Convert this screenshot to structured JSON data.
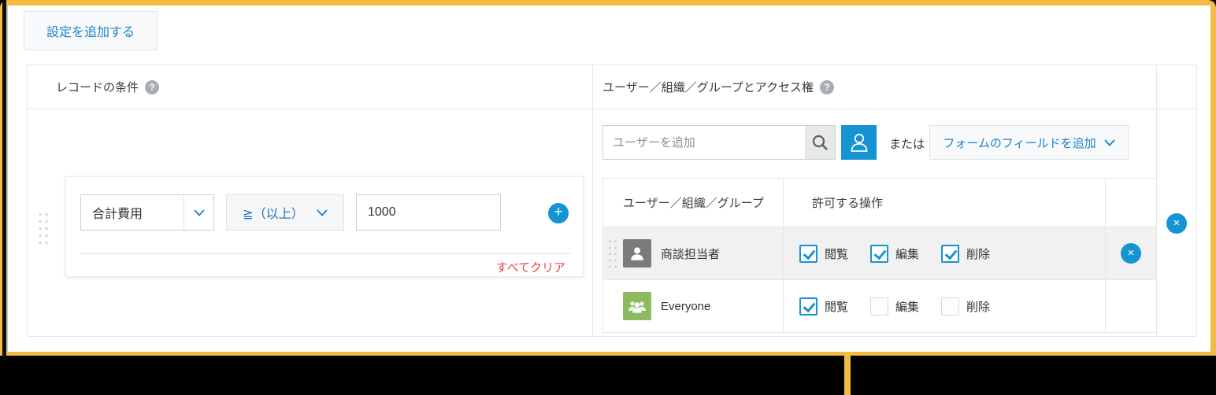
{
  "panel": {
    "add_setting_button": "設定を追加する"
  },
  "table": {
    "condition_header": "レコードの条件",
    "access_header": "ユーザー／組織／グループとアクセス権",
    "help_glyph": "?"
  },
  "condition": {
    "field": "合計費用",
    "operator": "≧（以上）",
    "value": "1000",
    "add_glyph": "+",
    "clear_all": "すべてクリア"
  },
  "access": {
    "search_placeholder": "ユーザーを追加",
    "or_text": "または",
    "form_field_button": "フォームのフィールドを追加",
    "columns": {
      "entity": "ユーザー／組織／グループ",
      "operations": "許可する操作"
    },
    "op_labels": {
      "view": "閲覧",
      "edit": "編集",
      "delete": "削除"
    },
    "remove_glyph": "×",
    "rows": [
      {
        "name": "商談担当者",
        "ops": {
          "view": true,
          "edit": true,
          "delete": true
        }
      },
      {
        "name": "Everyone",
        "ops": {
          "view": true,
          "edit": false,
          "delete": false
        }
      }
    ]
  },
  "colors": {
    "highlight_border": "#F2BC42",
    "primary_blue": "#1593D2",
    "link_blue": "#2083C8",
    "danger_red": "#E2483D"
  }
}
